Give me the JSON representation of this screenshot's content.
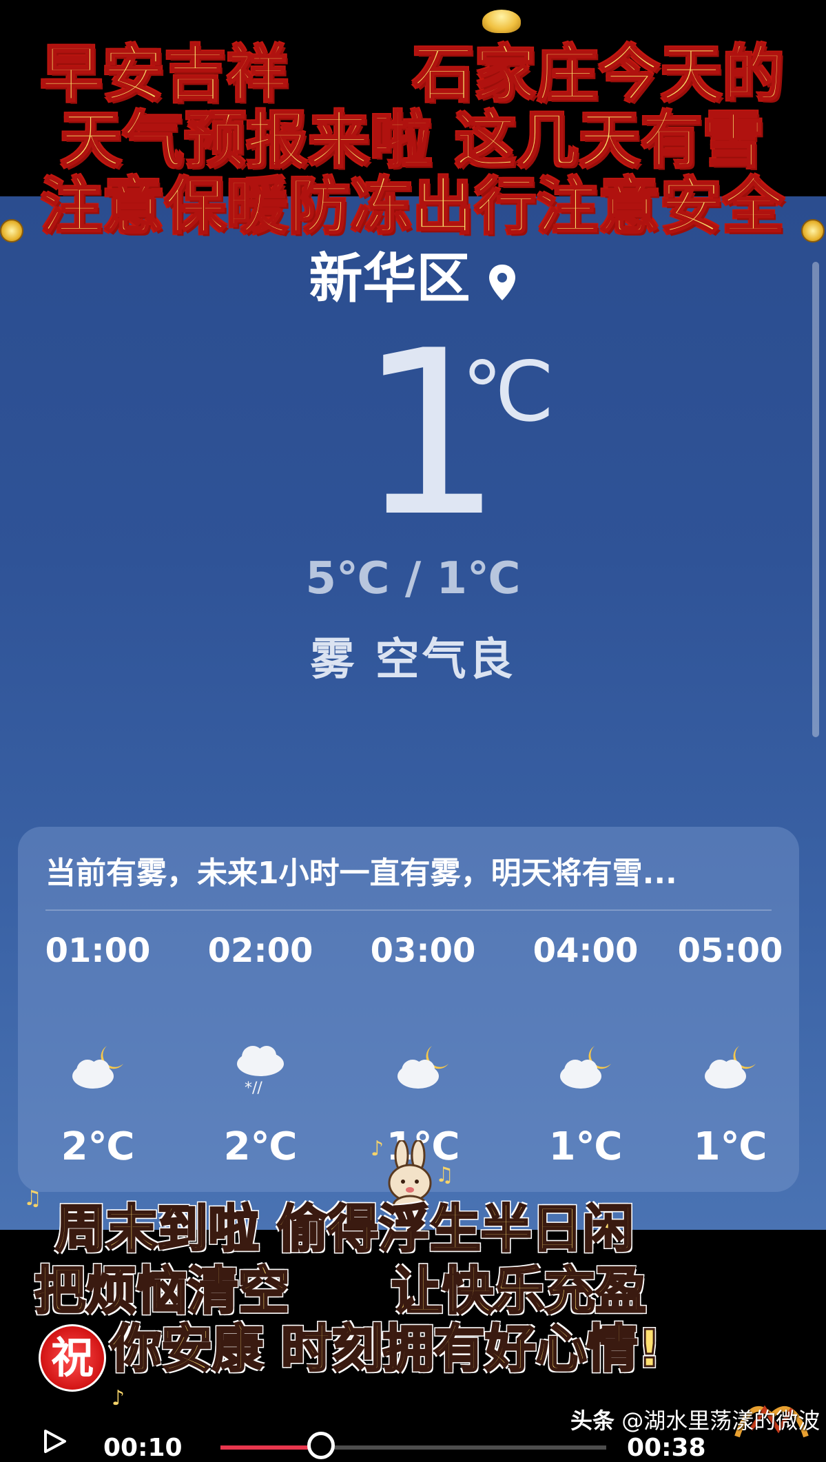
{
  "top_banner": {
    "line1": "早安吉祥　　石家庄今天的",
    "line2": "天气预报来啦  这几天有雪",
    "line3": "注意保暖防冻出行注意安全"
  },
  "weather": {
    "location": "新华区",
    "location_icon": "location-pin-icon",
    "current_temp": "1",
    "temp_unit": "℃",
    "high_low": "5℃ / 1℃",
    "condition": "雾  空气良",
    "summary": "当前有雾，未来1小时一直有雾，明天将有雪...",
    "hourly": [
      {
        "time": "01:00",
        "icon": "partly-cloudy-night-icon",
        "temp": "2℃"
      },
      {
        "time": "02:00",
        "icon": "snow-cloud-icon",
        "temp": "2℃"
      },
      {
        "time": "03:00",
        "icon": "partly-cloudy-night-icon",
        "temp": "1℃"
      },
      {
        "time": "04:00",
        "icon": "partly-cloudy-night-icon",
        "temp": "1℃"
      },
      {
        "time": "05:00",
        "icon": "partly-cloudy-night-icon",
        "temp": "1℃"
      }
    ]
  },
  "bottom_banner": {
    "line1": "周末到啦  偷得浮生半日闲",
    "line2": "把烦恼清空　　让快乐充盈",
    "badge": "祝",
    "line3": "你安康  时刻拥有好心情!"
  },
  "player": {
    "current_time": "00:10",
    "total_time": "00:38",
    "progress": 0.26
  },
  "watermark": {
    "brand": "头条",
    "author": "@湖水里荡漾的微波"
  },
  "colors": {
    "banner_fill": "#f8e06a",
    "banner_stroke": "#b0120f",
    "progress": "#e8364d",
    "sky": "#2f5397"
  }
}
